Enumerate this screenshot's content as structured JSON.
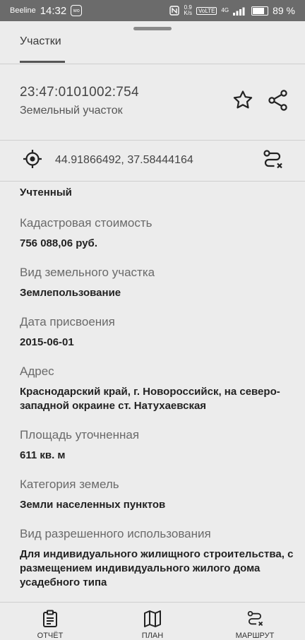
{
  "status_bar": {
    "carrier": "Beeline",
    "time": "14:32",
    "wo_badge": "wo",
    "net_speed_value": "0.9",
    "net_speed_unit": "K/s",
    "volte": "VoLTE",
    "network": "4G",
    "battery_percent": "89 %",
    "battery_level": 0.89
  },
  "tabs": {
    "active_label": "Участки"
  },
  "parcel": {
    "cadastral_number": "23:47:0101002:754",
    "type": "Земельный участок",
    "coordinates": "44.91866492, 37.58444164"
  },
  "details": {
    "status": "Учтенный",
    "fields": [
      {
        "label": "Кадастровая стоимость",
        "value": "756 088,06 руб."
      },
      {
        "label": "Вид земельного участка",
        "value": "Землепользование"
      },
      {
        "label": "Дата присвоения",
        "value": "2015-06-01"
      },
      {
        "label": "Адрес",
        "value": "Краснодарский край, г. Новороссийск, на северо-западной окраине ст. Натухаевская"
      },
      {
        "label": "Площадь уточненная",
        "value": "611 кв. м"
      },
      {
        "label": "Категория земель",
        "value": "Земли населенных пунктов"
      },
      {
        "label": "Вид разрешенного использования",
        "value": "Для индивидуального жилищного строительства, с размещением индивидуального жилого дома усадебного типа"
      }
    ]
  },
  "bottom_nav": {
    "report": "ОТЧЁТ",
    "plan": "ПЛАН",
    "route": "МАРШРУТ"
  },
  "icons": {
    "star": "star-icon",
    "share": "share-icon",
    "crosshair": "crosshair-icon",
    "route_clear": "route-clear-icon",
    "report": "clipboard-icon",
    "plan": "map-icon",
    "route": "route-icon"
  }
}
